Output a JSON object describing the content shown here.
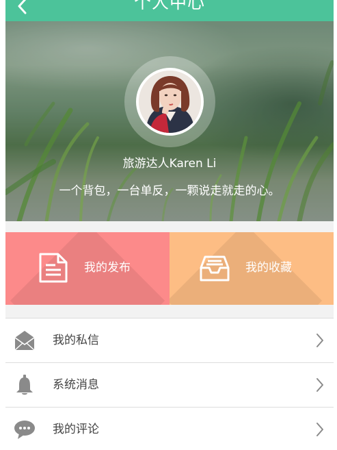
{
  "header": {
    "title": "个人中心",
    "back_icon": "chevron-left-icon",
    "background": "#4cc39a"
  },
  "profile": {
    "name": "旅游达人Karen Li",
    "bio": "一个背包，一台单反，一颗说走就走的心。"
  },
  "actions": [
    {
      "label": "我的发布",
      "icon": "document-icon",
      "color": "#fc8a8a"
    },
    {
      "label": "我的收藏",
      "icon": "inbox-tray-icon",
      "color": "#fdbd84"
    }
  ],
  "menu": [
    {
      "label": "我的私信",
      "icon": "envelope-icon"
    },
    {
      "label": "系统消息",
      "icon": "bell-icon"
    },
    {
      "label": "我的评论",
      "icon": "speech-bubble-icon"
    }
  ]
}
